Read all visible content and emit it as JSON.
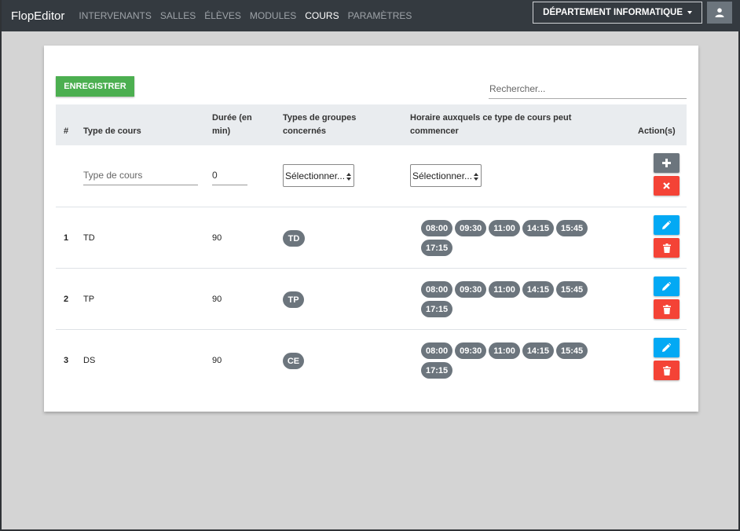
{
  "navbar": {
    "brand": "FlopEditor",
    "links": [
      "INTERVENANTS",
      "SALLES",
      "ÉLÈVES",
      "MODULES",
      "COURS",
      "PARAMÈTRES"
    ],
    "active": "COURS",
    "department": "DÉPARTEMENT INFORMATIQUE"
  },
  "toolbar": {
    "save_label": "ENREGISTRER",
    "search_placeholder": "Rechercher..."
  },
  "table": {
    "headers": {
      "num": "#",
      "type": "Type de cours",
      "duration": "Durée (en min)",
      "groups": "Types de groupes concernés",
      "schedule": "Horaire auxquels ce type de cours peut commencer",
      "actions": "Action(s)"
    },
    "new_row": {
      "type_placeholder": "Type de cours",
      "duration_value": "0",
      "groups_select": "Sélectionner...",
      "schedule_select": "Sélectionner..."
    },
    "rows": [
      {
        "num": "1",
        "type": "TD",
        "duration": "90",
        "group": "TD",
        "times": [
          "08:00",
          "09:30",
          "11:00",
          "14:15",
          "15:45",
          "17:15"
        ]
      },
      {
        "num": "2",
        "type": "TP",
        "duration": "90",
        "group": "TP",
        "times": [
          "08:00",
          "09:30",
          "11:00",
          "14:15",
          "15:45",
          "17:15"
        ]
      },
      {
        "num": "3",
        "type": "DS",
        "duration": "90",
        "group": "CE",
        "times": [
          "08:00",
          "09:30",
          "11:00",
          "14:15",
          "15:45",
          "17:15"
        ]
      }
    ]
  },
  "icons": {
    "add": "plus-icon",
    "cancel": "close-icon",
    "edit": "pencil-icon",
    "delete": "trash-icon",
    "user": "user-icon"
  },
  "colors": {
    "navbar": "#343a40",
    "save": "#4caf50",
    "edit": "#03a9f4",
    "delete": "#f44336",
    "badge": "#6c757d"
  }
}
